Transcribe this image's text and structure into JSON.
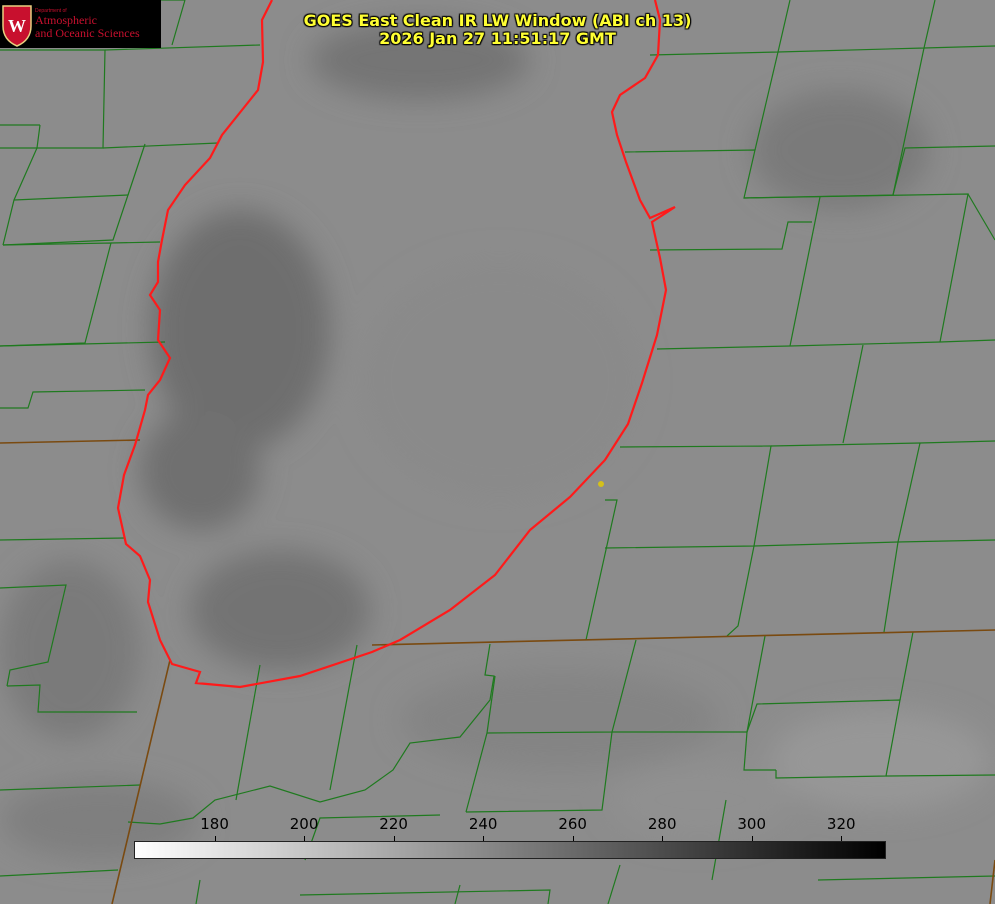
{
  "title": {
    "line1": "GOES East Clean IR LW Window (ABI ch 13)",
    "line2": "2026 Jan 27 11:51:17 GMT"
  },
  "logo": {
    "dept": "Department of",
    "line1": "Atmospheric",
    "line2": "and Oceanic Sciences",
    "crest_letter": "W"
  },
  "colorbar": {
    "ticks": [
      "180",
      "200",
      "220",
      "240",
      "260",
      "280",
      "300",
      "320"
    ],
    "min": 162,
    "max": 330,
    "from_color": "#ffffff",
    "to_color": "#000000"
  },
  "colors": {
    "county_lines": "#1f7a1f",
    "state_lines": "#7a4a10",
    "lake_outline": "#ff1a1a",
    "title_text": "#ffff33",
    "marker": "#d4c01a"
  }
}
